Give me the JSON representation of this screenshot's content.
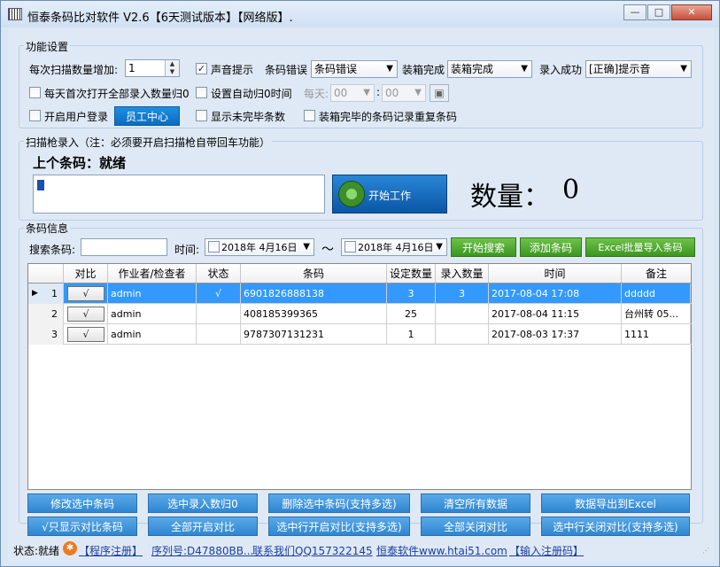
{
  "window": {
    "title": "恒泰条码比对软件 V2.6【6天测试版本】【网络版】.",
    "min": "—",
    "max": "□",
    "close": "✕"
  },
  "settings": {
    "group_title": "功能设置",
    "scan_increase_label": "每次扫描数量增加:",
    "scan_increase_value": "1",
    "sound_label": "声音提示",
    "sound_checked": "✓",
    "barcode_error_label": "条码错误",
    "barcode_error_value": "条码错误",
    "box_complete_label": "装箱完成",
    "box_complete_value": "装箱完成",
    "entry_success_label": "录入成功",
    "entry_success_value": "[正确]提示音",
    "daily_reset_label": "每天首次打开全部录入数量归0",
    "auto_reset_label": "设置自动归0时间",
    "daily_label": "每天:",
    "hour_value": "00",
    "minute_value": "00",
    "time_sep": ":",
    "user_login_label": "开启用户登录",
    "staff_center": "员工中心",
    "show_unfinished_label": "显示未完毕条数",
    "box_repeat_label": "装箱完毕的条码记录重复条码"
  },
  "scan": {
    "group_title": "扫描枪录入（注：必须要开启扫描枪自带回车功能）",
    "last_barcode": "上个条码：就绪",
    "start_button": "开始工作",
    "count_label": "数量：",
    "count_value": "0"
  },
  "info": {
    "group_title": "条码信息",
    "search_label": "搜索条码:",
    "time_label": "时间:",
    "date_from": "2018年 4月16日",
    "date_to": "2018年 4月16日",
    "tilde": "～",
    "search_button": "开始搜索",
    "add_button": "添加条码",
    "import_button": "Excel批量导入条码"
  },
  "table": {
    "headers": [
      "对比",
      "作业者/检查者",
      "状态",
      "条码",
      "设定数量",
      "录入数量",
      "时间",
      "备注"
    ],
    "rows": [
      {
        "idx": "1",
        "compare": "√",
        "operator": "admin",
        "status": "√",
        "barcode": "6901826888138",
        "set": "3",
        "entered": "3",
        "time": "2017-08-04 17:08",
        "note": "ddddd",
        "marker": "▶"
      },
      {
        "idx": "2",
        "compare": "√",
        "operator": "admin",
        "status": "",
        "barcode": "408185399365",
        "set": "25",
        "entered": "",
        "time": "2017-08-04 11:15",
        "note": "台州转 05...",
        "marker": ""
      },
      {
        "idx": "3",
        "compare": "√",
        "operator": "admin",
        "status": "",
        "barcode": "9787307131231",
        "set": "1",
        "entered": "",
        "time": "2017-08-03 17:37",
        "note": "1111",
        "marker": ""
      }
    ]
  },
  "buttons": {
    "row1": [
      "修改选中条码",
      "选中录入数归0",
      "删除选中条码(支持多选)",
      "清空所有数据",
      "数据导出到Excel"
    ],
    "row2": [
      "√只显示对比条码",
      "全部开启对比",
      "选中行开启对比(支持多选)",
      "全部关闭对比",
      "选中行关闭对比(支持多选)"
    ]
  },
  "status": {
    "state": "状态:就绪",
    "register": "【程序注册】",
    "serial": "序列号:D47880BB...",
    "contact": "联系我们QQ157322145",
    "website": "恒泰软件www.htai51.com",
    "enter_code": "【输入注册码】"
  }
}
